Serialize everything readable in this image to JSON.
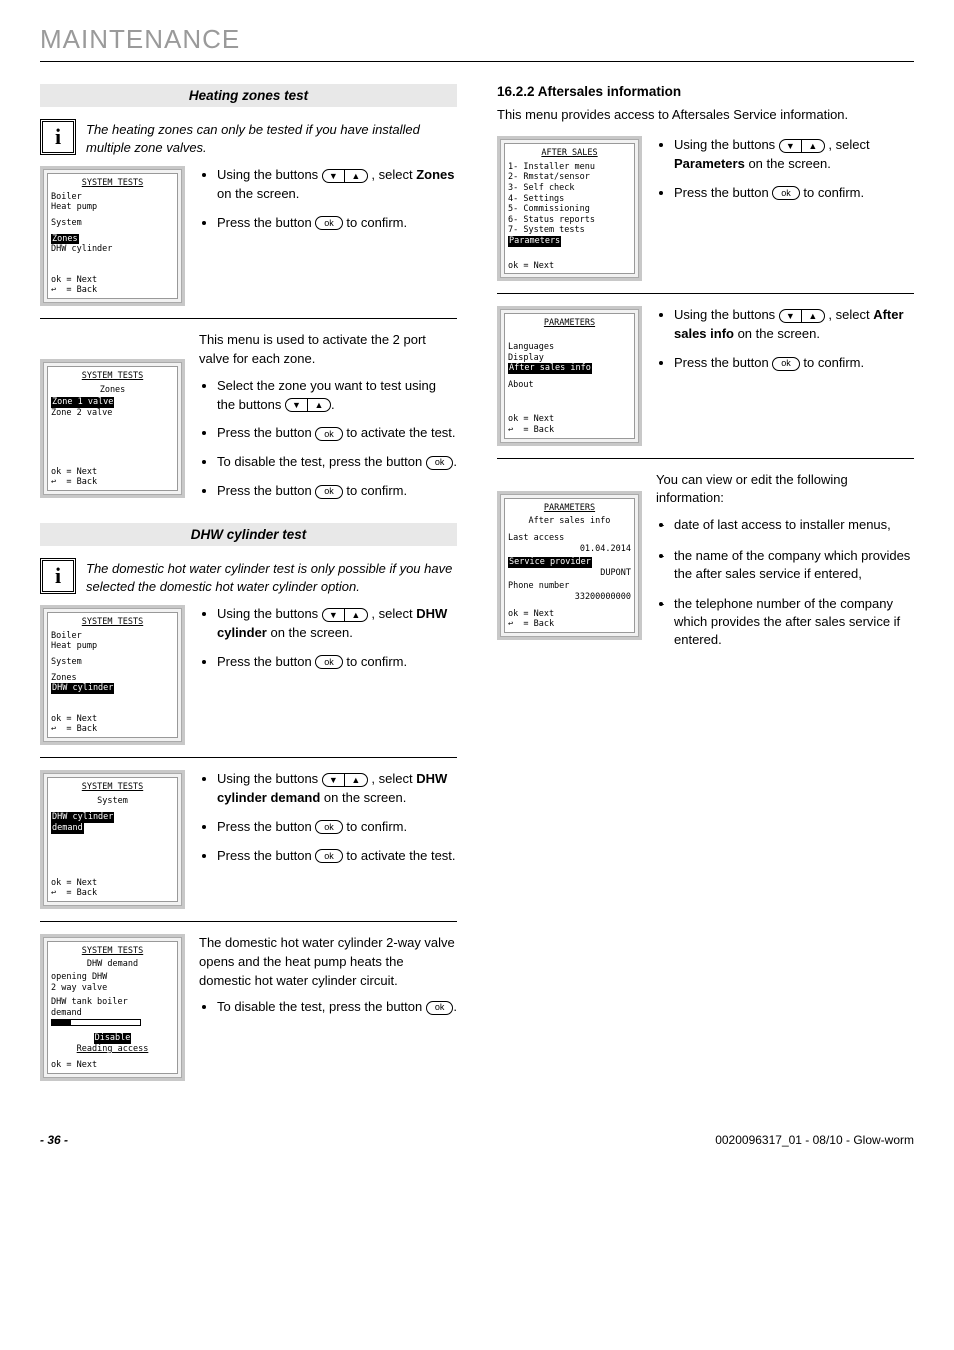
{
  "pageTitle": "MAINTENANCE",
  "left": {
    "heatingZonesHeader": "Heating zones test",
    "info1": "The heating zones can only be tested if you have installed multiple zone valves.",
    "dhwHeader": "DHW cylinder test",
    "info2": "The domestic hot water cylinder test is only possible if you have selected the domestic hot water cylinder option.",
    "lcd1": {
      "title": "SYSTEM TESTS",
      "l1": "Boiler",
      "l2": "Heat pump",
      "l3": "System",
      "hl": "Zones",
      "l5": "DHW cylinder",
      "foot1": "ok = Next",
      "foot2": "↩  = Back"
    },
    "inst1a_pre": "Using the buttons ",
    "inst1a_post": " , select ",
    "inst1a_bold": "Zones",
    "inst1a_end": " on the screen.",
    "inst1b_pre": "Press the button ",
    "inst1b_post": " to confirm.",
    "intro2": "This menu is used to activate the 2 port valve for each zone.",
    "lcd2": {
      "title": "SYSTEM TESTS",
      "sub": "Zones",
      "hl": "Zone 1 valve",
      "l2": "Zone 2 valve",
      "foot1": "ok = Next",
      "foot2": "↩  = Back"
    },
    "inst2a_pre": "Select the zone you want to test using the buttons ",
    "inst2a_post": ".",
    "inst2b_pre": "Press the button ",
    "inst2b_post": " to activate the test.",
    "inst2c_pre": "To disable the test, press the button ",
    "inst2c_post": ".",
    "inst2d_pre": "Press the button ",
    "inst2d_post": " to confirm.",
    "lcd3": {
      "title": "SYSTEM TESTS",
      "l1": "Boiler",
      "l2": "Heat pump",
      "l3": "System",
      "l4": "Zones",
      "hl": "DHW cylinder",
      "foot1": "ok = Next",
      "foot2": "↩  = Back"
    },
    "inst3a_pre": "Using the buttons ",
    "inst3a_post": " , select ",
    "inst3a_bold": "DHW cylinder",
    "inst3a_end": " on the screen.",
    "inst3b_pre": "Press the button ",
    "inst3b_post": " to confirm.",
    "lcd4": {
      "title": "SYSTEM TESTS",
      "sub": "System",
      "hl": "DHW cylinder\ndemand",
      "foot1": "ok = Next",
      "foot2": "↩  = Back"
    },
    "inst4a_pre": "Using the buttons ",
    "inst4a_post": " , select ",
    "inst4a_bold": "DHW cylinder demand",
    "inst4a_end": " on the screen.",
    "inst4b_pre": "Press the button ",
    "inst4b_post": " to confirm.",
    "inst4c_pre": "Press the button ",
    "inst4c_post": " to activate the test.",
    "lcd5": {
      "title": "SYSTEM TESTS",
      "sub": "DHW demand",
      "l1": "opening DHW",
      "l2": "2 way valve",
      "l3": "DHW tank boiler",
      "l4": "demand",
      "hl": "Disable",
      "l6": "Reading access",
      "foot1": "ok = Next"
    },
    "para5": "The domestic hot water cylinder 2-way valve opens and the heat pump heats the domestic hot water cylinder circuit.",
    "inst5a_pre": "To disable the test, press the button ",
    "inst5a_post": "."
  },
  "right": {
    "heading": "16.2.2    Aftersales information",
    "intro": "This menu provides access to Aftersales Service information.",
    "lcd1": {
      "title": "AFTER SALES",
      "l1": "1- Installer menu",
      "l2": "2- Rmstat/sensor",
      "l3": "3- Self check",
      "l4": "4- Settings",
      "l5": "5- Commissioning",
      "l6": "6- Status reports",
      "l7": "7- System tests",
      "hl": "Parameters",
      "foot1": "ok = Next"
    },
    "inst1a_pre": "Using the buttons ",
    "inst1a_post": " , select ",
    "inst1a_bold": "Parameters",
    "inst1a_end": " on the screen.",
    "inst1b_pre": "Press the button ",
    "inst1b_post": " to confirm.",
    "lcd2": {
      "title": "PARAMETERS",
      "l1": "Languages",
      "l2": "Display",
      "hl": "After sales info",
      "l4": "About",
      "foot1": "ok = Next",
      "foot2": "↩  = Back"
    },
    "inst2a_pre": "Using the buttons ",
    "inst2a_post": " , select ",
    "inst2a_bold": "After sales info",
    "inst2a_end": " on the screen.",
    "inst2b_pre": "Press the button ",
    "inst2b_post": " to confirm.",
    "lcd3": {
      "title": "PARAMETERS",
      "sub": "After sales info",
      "l1": "Last access",
      "r1": "01.04.2014",
      "hl": "Service provider",
      "r2": "DUPONT",
      "l3": "Phone number",
      "r3": "33200000000",
      "foot1": "ok = Next",
      "foot2": "↩  = Back"
    },
    "para3": "You can view or edit the following information:",
    "dash1": "date of last access to installer menus,",
    "dash2": "the name of the company which provides the after sales service if entered,",
    "dash3": "the telephone number of the company which provides the after sales service if entered."
  },
  "footer": {
    "pageNum": "- 36 -",
    "docRef": "0020096317_01 - 08/10 - Glow-worm"
  },
  "okLabel": "ok"
}
